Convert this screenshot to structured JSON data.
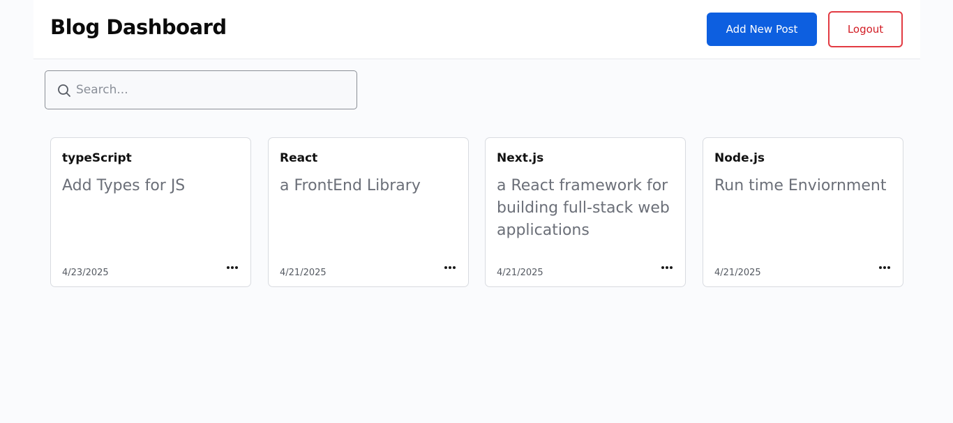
{
  "header": {
    "title": "Blog Dashboard",
    "add_post_label": "Add New Post",
    "logout_label": "Logout"
  },
  "search": {
    "placeholder": "Search..."
  },
  "posts": [
    {
      "title": "typeScript",
      "body": "Add Types for JS",
      "date": "4/23/2025"
    },
    {
      "title": "React",
      "body": "a FrontEnd Library",
      "date": "4/21/2025"
    },
    {
      "title": "Next.js",
      "body": "a React framework for building full-stack web applications",
      "date": "4/21/2025"
    },
    {
      "title": "Node.js",
      "body": "Run time Enviornment",
      "date": "4/21/2025"
    }
  ],
  "icons": {
    "search": "search-icon",
    "menu": "more-horizontal-icon"
  },
  "colors": {
    "primary": "#0d5fe0",
    "danger": "#d21c24",
    "background": "#fafbfd"
  }
}
